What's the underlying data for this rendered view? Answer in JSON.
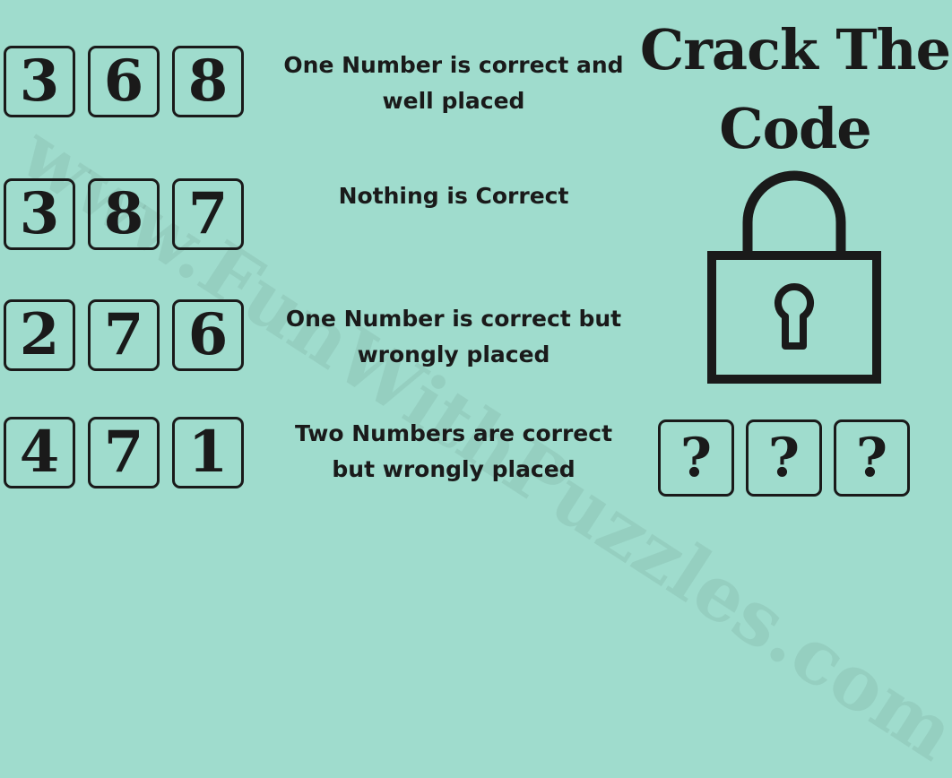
{
  "title": "Crack The Code",
  "watermark": "www.FunWithPuzzles.com",
  "clues": [
    {
      "digits": [
        "3",
        "6",
        "8"
      ],
      "line1": "One Number is correct and",
      "line2": "well placed"
    },
    {
      "digits": [
        "3",
        "8",
        "7"
      ],
      "line1": "Nothing is Correct",
      "line2": ""
    },
    {
      "digits": [
        "2",
        "7",
        "6"
      ],
      "line1": "One Number is correct but",
      "line2": "wrongly placed"
    },
    {
      "digits": [
        "4",
        "7",
        "1"
      ],
      "line1": "Two Numbers are correct",
      "line2": "but wrongly placed"
    }
  ],
  "answer": [
    "?",
    "?",
    "?"
  ],
  "icons": {
    "lock": "padlock-icon"
  },
  "colors": {
    "background": "#9fdccd",
    "ink": "#1a1a1a"
  }
}
